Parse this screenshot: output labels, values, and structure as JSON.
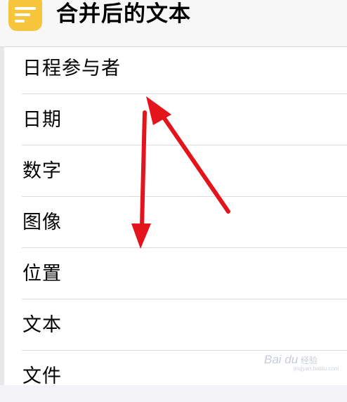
{
  "header": {
    "title": "合并后的文本",
    "icon": "menu-lines-icon",
    "icon_color": "#f7c53c"
  },
  "list": {
    "items": [
      {
        "label": "日程参与者"
      },
      {
        "label": "日期"
      },
      {
        "label": "数字"
      },
      {
        "label": "图像"
      },
      {
        "label": "位置"
      },
      {
        "label": "文本"
      },
      {
        "label": "文件"
      }
    ]
  },
  "annotations": {
    "arrow_color": "#e3141b",
    "arrows": [
      "arrow-up-icon",
      "arrow-down-icon"
    ]
  },
  "watermark": {
    "brand": "Bai du",
    "sub": "经验",
    "url": "jingyan.baidu.com"
  }
}
